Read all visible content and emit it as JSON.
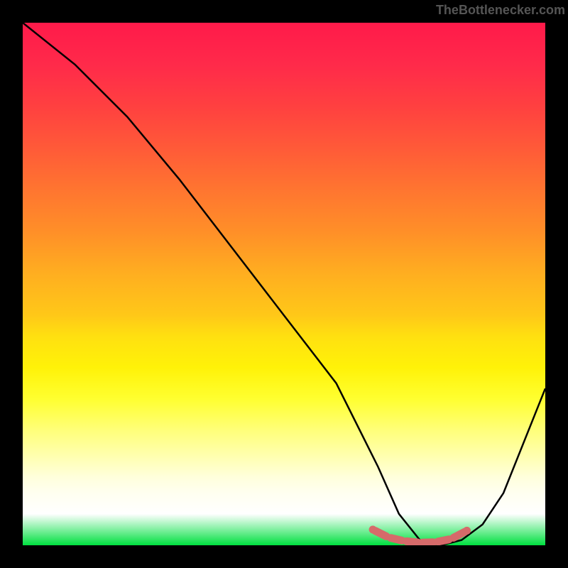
{
  "attribution": "TheBottlenecker.com",
  "chart_data": {
    "type": "line",
    "title": "",
    "xlabel": "",
    "ylabel": "",
    "xlim": [
      0,
      100
    ],
    "ylim": [
      0,
      100
    ],
    "series": [
      {
        "name": "bottleneck-curve",
        "x": [
          0,
          10,
          20,
          30,
          40,
          50,
          60,
          68,
          72,
          76,
          80,
          84,
          88,
          92,
          100
        ],
        "y": [
          100,
          92,
          82,
          70,
          57,
          44,
          31,
          15,
          6,
          1,
          0,
          1,
          4,
          10,
          30
        ]
      }
    ],
    "marker_segment": {
      "x": [
        67,
        70,
        73,
        76,
        79,
        82,
        85
      ],
      "y": [
        3,
        1.5,
        0.8,
        0.5,
        0.6,
        1.2,
        2.8
      ]
    },
    "gradient_stops": [
      {
        "pct": 0,
        "color": "#ff1a4a"
      },
      {
        "pct": 50,
        "color": "#ffc818"
      },
      {
        "pct": 80,
        "color": "#ffff60"
      },
      {
        "pct": 100,
        "color": "#00e040"
      }
    ]
  }
}
